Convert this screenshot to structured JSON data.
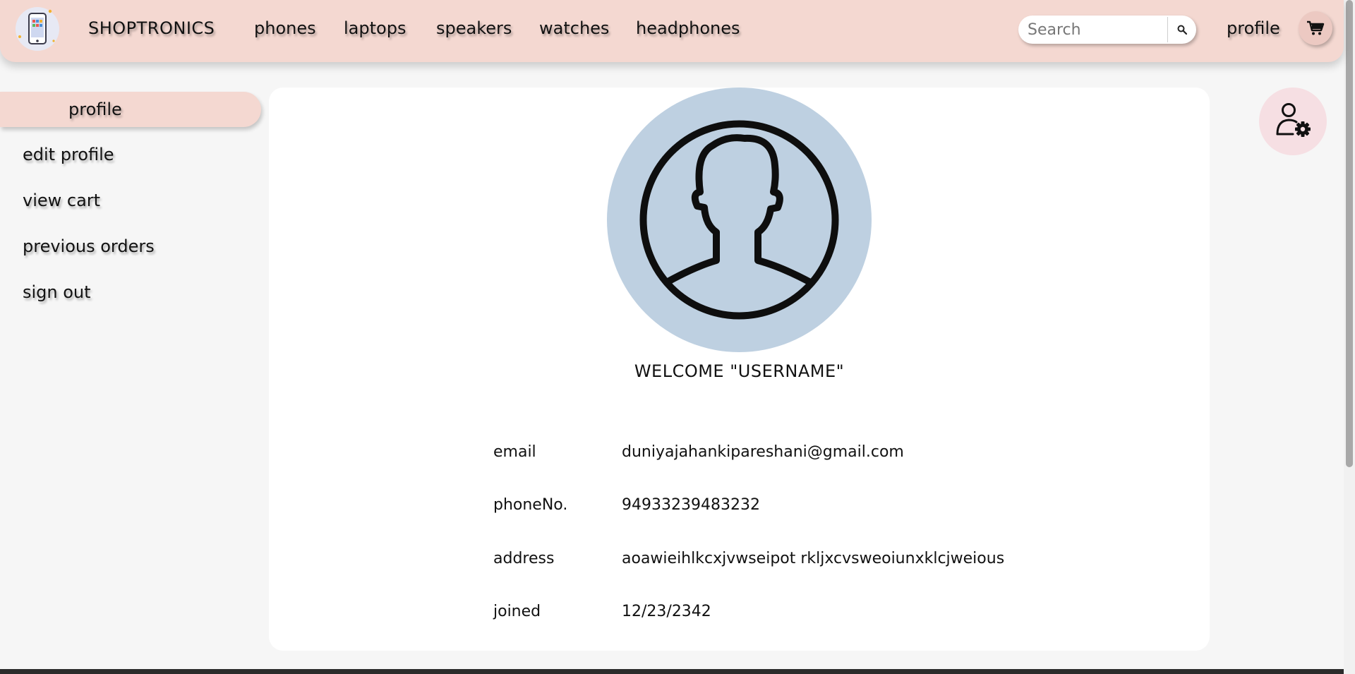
{
  "navbar": {
    "brand": "SHOPTRONICS",
    "links": [
      "phones",
      "laptops",
      "speakers",
      "watches",
      "headphones"
    ],
    "search_placeholder": "Search",
    "profile_label": "profile",
    "icons": {
      "logo": "phone-logo-icon",
      "search": "search-icon",
      "cart": "cart-icon"
    }
  },
  "sidebar": {
    "active": "profile",
    "items": [
      "edit profile",
      "view cart",
      "previous orders",
      "sign out"
    ]
  },
  "profile": {
    "welcome": "WELCOME \"USERNAME\"",
    "fields": [
      {
        "label": "email",
        "value": "duniyajahankipareshani@gmail.com"
      },
      {
        "label": "phoneNo.",
        "value": "94933239483232"
      },
      {
        "label": "address",
        "value": "aoawieihlkcxjvwseipot rkljxcvsweoiunxklcjweious"
      },
      {
        "label": "joined",
        "value": "12/23/2342"
      }
    ]
  },
  "colors": {
    "navbar_bg": "#f4d8d1",
    "avatar_bg": "#bed0e1",
    "settings_bg": "#f6dfe3",
    "card_bg": "#ffffff",
    "page_bg": "#f6f6f6"
  }
}
